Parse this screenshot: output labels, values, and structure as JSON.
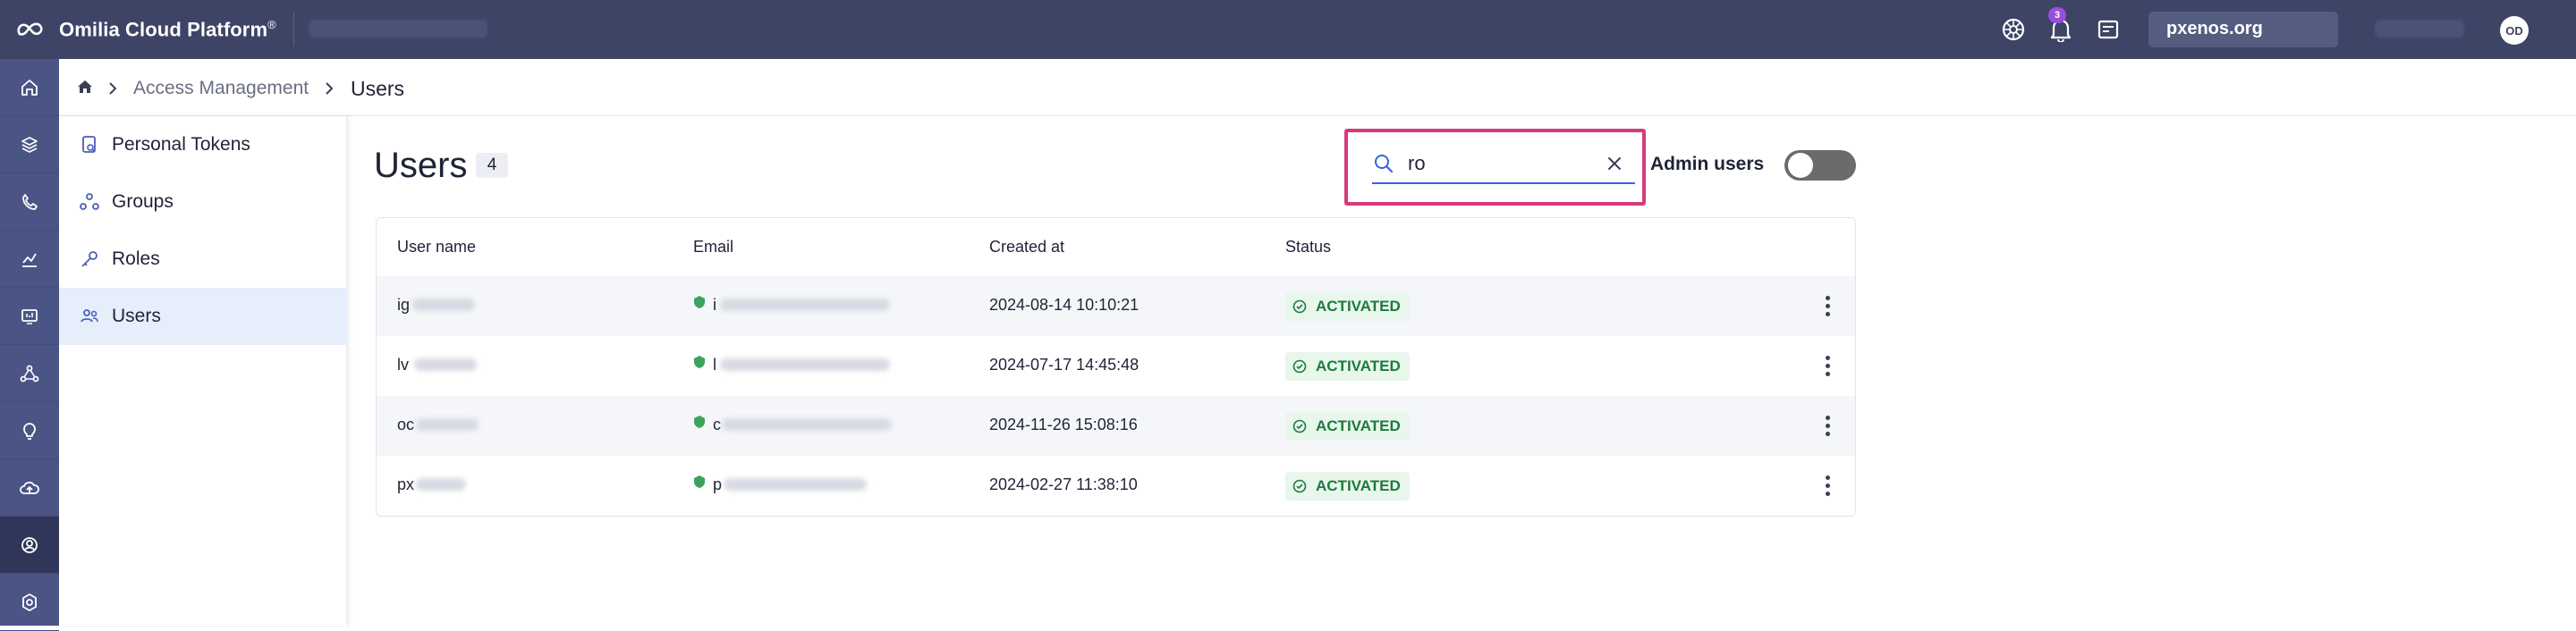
{
  "app": {
    "brand": "Omilia Cloud Platform",
    "brand_mark": "®",
    "notifications_count": "3",
    "org": "pxenos.org",
    "avatar_initials": "OD"
  },
  "rail": {
    "items": [
      "home-icon",
      "layers-icon",
      "phone-icon",
      "chart-icon",
      "monitor-icon",
      "flow-icon",
      "bulb-icon",
      "cloud-upload-icon",
      "access-management-icon",
      "settings-icon"
    ],
    "active_index": 8
  },
  "breadcrumb": {
    "items": [
      "Access Management"
    ],
    "current": "Users"
  },
  "subnav": {
    "items": [
      {
        "label": "Personal Tokens",
        "icon": "token-icon"
      },
      {
        "label": "Groups",
        "icon": "groups-icon"
      },
      {
        "label": "Roles",
        "icon": "key-icon"
      },
      {
        "label": "Users",
        "icon": "users-icon"
      }
    ],
    "active": "Users"
  },
  "main": {
    "title": "Users",
    "count": "4",
    "search": {
      "value": "ro",
      "placeholder": ""
    },
    "admin_users_label": "Admin users",
    "admin_users_enabled": false
  },
  "table": {
    "columns": [
      "User name",
      "Email",
      "Created at",
      "Status"
    ],
    "rows": [
      {
        "user": "ig",
        "email": "i",
        "created": "2024-08-14 10:10:21",
        "status": "ACTIVATED"
      },
      {
        "user": "lv",
        "email": "l",
        "created": "2024-07-17 14:45:48",
        "status": "ACTIVATED"
      },
      {
        "user": "oc",
        "email": "c",
        "created": "2024-11-26 15:08:16",
        "status": "ACTIVATED"
      },
      {
        "user": "px",
        "email": "p",
        "created": "2024-02-27 11:38:10",
        "status": "ACTIVATED"
      }
    ]
  },
  "colors": {
    "topbar": "#3d4466",
    "rail": "#4a5485",
    "accent": "#3565e0",
    "highlight": "#d63a7e",
    "status_green": "#1e7a3c"
  }
}
